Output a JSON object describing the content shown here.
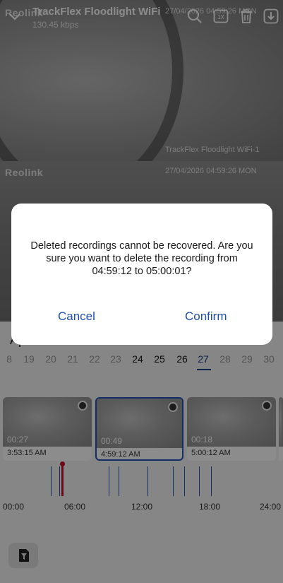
{
  "header": {
    "camera_name": "TrackFlex Floodlight WiFi",
    "bitrate": "130.45 kbps"
  },
  "video": {
    "logo": "Reolink",
    "overlay_top_timestamp": "27/04/2026 04:59:26 MON",
    "overlay_camera_label": "TrackFlex Floodlight WiFi-1",
    "overlay_logo_2": "Reolink",
    "overlay_timestamp_2": "27/04/2026 04:59:26 MON"
  },
  "toolbar": {
    "icons": [
      "search-icon",
      "speed-1x-icon",
      "trash-icon",
      "download-icon"
    ],
    "speed_label": "1X"
  },
  "calendar": {
    "month_partial": "Ap",
    "days": [
      "8",
      "19",
      "20",
      "21",
      "22",
      "23",
      "24",
      "25",
      "26",
      "27",
      "28",
      "29",
      "30"
    ],
    "available_days": [
      "24",
      "25",
      "26",
      "27"
    ],
    "selected_day": "27"
  },
  "clips": [
    {
      "duration": "00:27",
      "time": "3:53:15 AM"
    },
    {
      "duration": "00:49",
      "time": "4:59:12 AM"
    },
    {
      "duration": "00:18",
      "time": "5:00:12 AM"
    }
  ],
  "timeline": {
    "labels": [
      "00:00",
      "06:00",
      "12:00",
      "18:00",
      "24:00"
    ]
  },
  "dialog": {
    "message": "Deleted recordings cannot be recovered. Are you sure you want to delete the recording from 04:59:12 to 05:00:01?",
    "cancel_label": "Cancel",
    "confirm_label": "Confirm"
  },
  "colors": {
    "accent": "#1e4fb0",
    "cursor": "#c8102e",
    "selected_clip_border": "#2553b8"
  }
}
